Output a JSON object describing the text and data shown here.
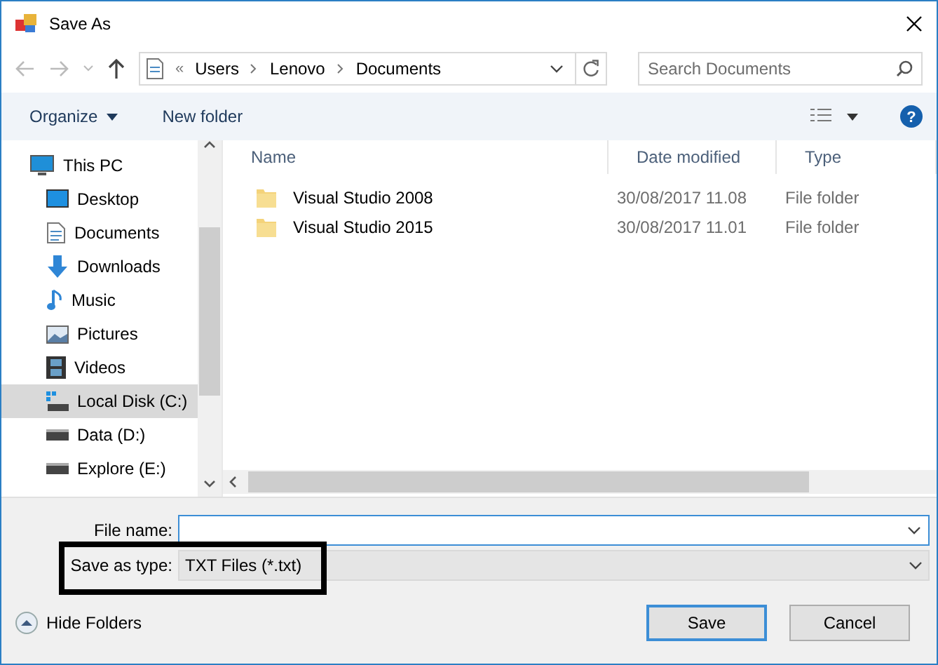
{
  "window": {
    "title": "Save As"
  },
  "address": {
    "separator": "«",
    "crumbs": [
      "Users",
      "Lenovo",
      "Documents"
    ]
  },
  "search": {
    "placeholder": "Search Documents"
  },
  "toolbar": {
    "organize": "Organize",
    "new_folder": "New folder",
    "help": "?"
  },
  "sidebar": {
    "items": [
      {
        "label": "This PC",
        "kind": "pc",
        "selected": false,
        "children": [
          {
            "label": "Desktop",
            "kind": "desktop",
            "selected": false
          },
          {
            "label": "Documents",
            "kind": "documents",
            "selected": false
          },
          {
            "label": "Downloads",
            "kind": "downloads",
            "selected": false
          },
          {
            "label": "Music",
            "kind": "music",
            "selected": false
          },
          {
            "label": "Pictures",
            "kind": "pictures",
            "selected": false
          },
          {
            "label": "Videos",
            "kind": "videos",
            "selected": false
          },
          {
            "label": "Local Disk (C:)",
            "kind": "system-drive",
            "selected": true
          },
          {
            "label": "Data (D:)",
            "kind": "drive",
            "selected": false
          },
          {
            "label": "Explore (E:)",
            "kind": "drive",
            "selected": false
          }
        ]
      }
    ]
  },
  "table": {
    "columns": [
      "Name",
      "Date modified",
      "Type"
    ],
    "rows": [
      {
        "name": "Visual Studio 2008",
        "date": "30/08/2017 11.08",
        "type": "File folder"
      },
      {
        "name": "Visual Studio 2015",
        "date": "30/08/2017 11.01",
        "type": "File folder"
      }
    ]
  },
  "file_name": {
    "label": "File name:"
  },
  "save_as_type": {
    "label": "Save as type:",
    "value": "TXT Files (*.txt)",
    "highlighted": true
  },
  "hide_folders": "Hide Folders",
  "buttons": [
    {
      "label": "Save",
      "default": true
    },
    {
      "label": "Cancel",
      "default": false
    }
  ]
}
